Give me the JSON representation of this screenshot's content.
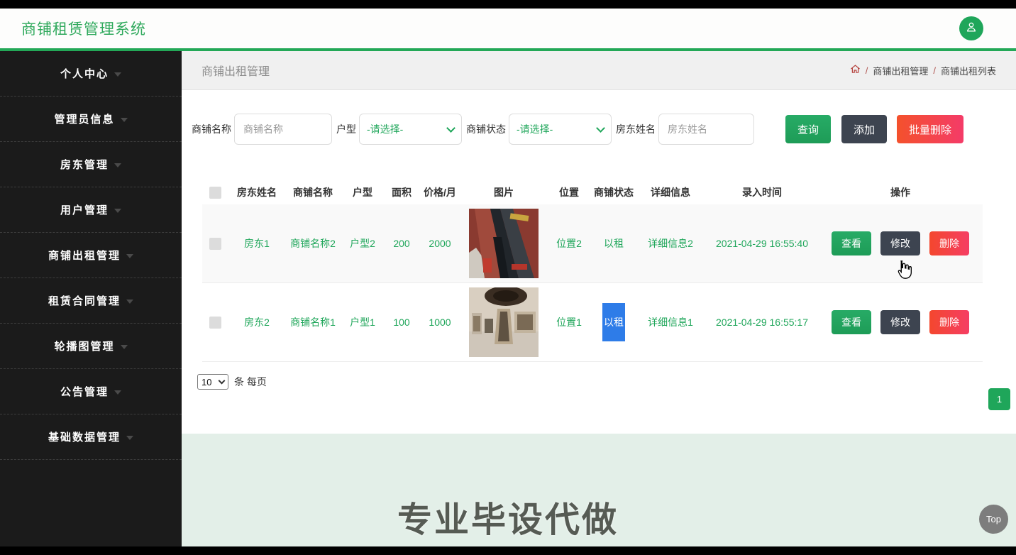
{
  "app": {
    "title": "商铺租赁管理系统"
  },
  "sidebar": {
    "items": [
      {
        "label": "个人中心"
      },
      {
        "label": "管理员信息"
      },
      {
        "label": "房东管理"
      },
      {
        "label": "用户管理"
      },
      {
        "label": "商铺出租管理"
      },
      {
        "label": "租赁合同管理"
      },
      {
        "label": "轮播图管理"
      },
      {
        "label": "公告管理"
      },
      {
        "label": "基础数据管理"
      }
    ]
  },
  "breadcrumb": {
    "page_title": "商铺出租管理",
    "separator": "/",
    "crumb1": "商铺出租管理",
    "crumb2": "商铺出租列表"
  },
  "filters": {
    "shop_name": {
      "label": "商铺名称",
      "placeholder": "商铺名称",
      "value": ""
    },
    "unit_type": {
      "label": "户型",
      "selected": "-请选择-"
    },
    "shop_status": {
      "label": "商铺状态",
      "selected": "-请选择-"
    },
    "landlord_name": {
      "label": "房东姓名",
      "placeholder": "房东姓名",
      "value": ""
    },
    "buttons": {
      "query": "查询",
      "add": "添加",
      "batch_delete": "批量删除"
    }
  },
  "table": {
    "columns": [
      "房东姓名",
      "商铺名称",
      "户型",
      "面积",
      "价格/月",
      "图片",
      "位置",
      "商铺状态",
      "详细信息",
      "录入时间",
      "操作"
    ],
    "row_actions": {
      "view": "查看",
      "edit": "修改",
      "delete": "删除"
    },
    "rows": [
      {
        "landlord": "房东1",
        "shop_name": "商铺名称2",
        "unit": "户型2",
        "area": "200",
        "price": "2000",
        "image": "storefront-photo",
        "location": "位置2",
        "status": "以租",
        "detail": "详细信息2",
        "time": "2021-04-29 16:55:40",
        "status_selected": false
      },
      {
        "landlord": "房东2",
        "shop_name": "商铺名称1",
        "unit": "户型1",
        "area": "100",
        "price": "1000",
        "image": "shop-interior-photo",
        "location": "位置1",
        "status": "以租",
        "detail": "详细信息1",
        "time": "2021-04-29 16:55:17",
        "status_selected": true
      }
    ]
  },
  "pagination": {
    "page_size": "10",
    "per_page_label": "条 每页",
    "current_page": "1"
  },
  "footer": {
    "watermark": "专业毕设代做",
    "top_label": "Top"
  },
  "colors": {
    "accent_green": "#1fa65a",
    "dark_button": "#3d4450",
    "danger_red": "#f43b68",
    "selection_blue": "#2e7ce8",
    "sidebar_bg": "#1b1b1b",
    "footer_green": "#e3efe8"
  }
}
